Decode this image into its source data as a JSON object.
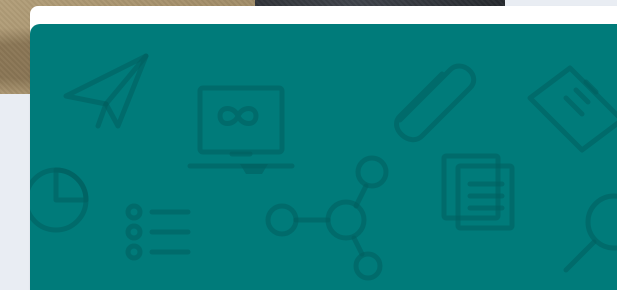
{
  "hero": {
    "background_color": "#007b7a",
    "icon_color": "#005f5e",
    "icons": [
      "paper-plane-icon",
      "laptop-icon",
      "paperclip-icon",
      "ruler-icon",
      "pie-chart-icon",
      "list-icon",
      "network-icon",
      "documents-icon",
      "search-icon"
    ]
  },
  "page": {
    "background_color": "#e9edf3"
  }
}
